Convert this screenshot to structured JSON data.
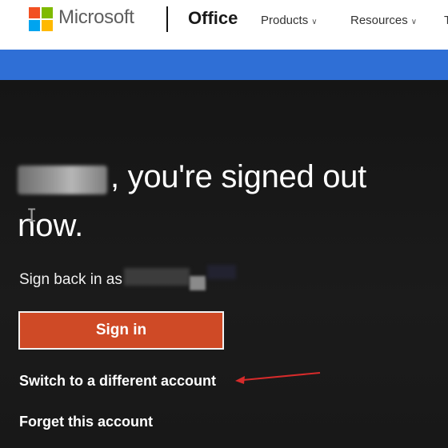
{
  "header": {
    "brand": "Microsoft",
    "product": "Office",
    "nav": [
      {
        "label": "Products"
      },
      {
        "label": "Resources"
      }
    ],
    "nav_overflow_char": "T",
    "logo_colors": [
      "#f25022",
      "#7fba00",
      "#00a4ef",
      "#ffb900"
    ]
  },
  "colors": {
    "accent_blue": "#2f6fd6",
    "signin_orange": "#cf4a26",
    "annotation_red": "#d62b2b",
    "hero_bg": "#181818"
  },
  "main": {
    "headline_line1": ", you're signed out",
    "headline_line2": "now.",
    "sign_back_text": "Sign back in as",
    "sign_in_label": "Sign in",
    "switch_account_label": "Switch to a different account",
    "forget_account_label": "Forget this account"
  }
}
